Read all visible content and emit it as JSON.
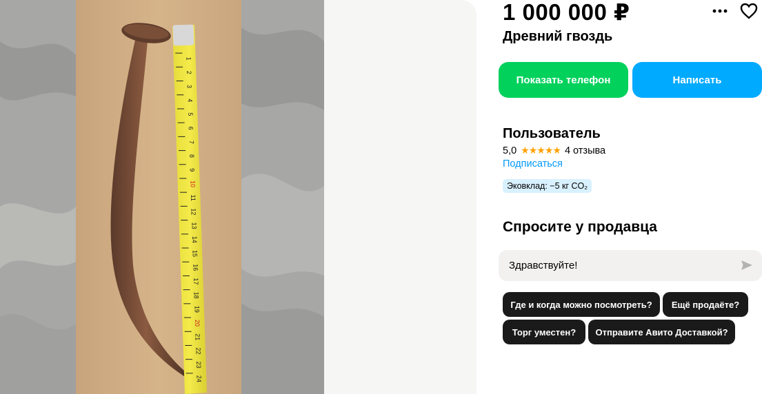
{
  "listing": {
    "price": "1 000 000 ₽",
    "title": "Древний гвоздь"
  },
  "actions": {
    "show_phone": "Показать телефон",
    "write": "Написать"
  },
  "seller": {
    "name": "Пользователь",
    "rating": "5,0",
    "stars": "★★★★★",
    "reviews": "4 отзыва",
    "subscribe": "Подписаться",
    "eco_badge": "Эковклад: −5 кг CO₂"
  },
  "ask": {
    "title": "Спросите у продавца",
    "input_value": "Здравствуйте!",
    "chips": [
      "Где и когда можно посмотреть?",
      "Ещё продаёте?",
      "Торг уместен?",
      "Отправите Авито Доставкой?"
    ]
  },
  "icons": {
    "more": "more-dots-icon",
    "favorite": "heart-icon",
    "send": "send-icon"
  },
  "colors": {
    "phone_button": "#02d15c",
    "write_button": "#00aaff",
    "link": "#0099f7",
    "star": "#ffa100",
    "chip": "#1a1a1a"
  },
  "photo": {
    "tape_numbers": [
      "1",
      "2",
      "3",
      "4",
      "5",
      "6",
      "7",
      "8",
      "9",
      "10",
      "11",
      "12",
      "13",
      "14",
      "15",
      "16",
      "17",
      "18",
      "19",
      "20",
      "21",
      "22",
      "23",
      "24"
    ]
  }
}
